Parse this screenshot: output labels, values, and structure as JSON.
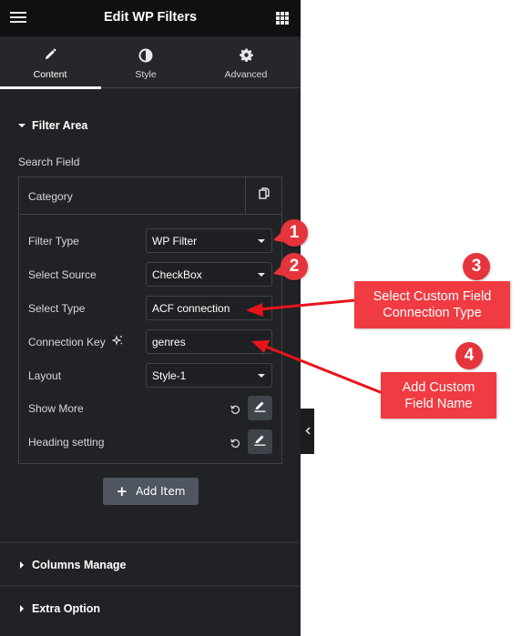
{
  "header": {
    "title": "Edit WP Filters",
    "menu_icon": "hamburger-icon",
    "apps_icon": "grid-icon"
  },
  "tabs": [
    {
      "label": "Content",
      "icon": "pencil-icon",
      "active": true
    },
    {
      "label": "Style",
      "icon": "half-circle-icon",
      "active": false
    },
    {
      "label": "Advanced",
      "icon": "gear-icon",
      "active": false
    }
  ],
  "filter_area": {
    "title": "Filter Area",
    "search_field_label": "Search Field",
    "item": {
      "name": "Category",
      "duplicate_icon": "copy-icon",
      "fields": [
        {
          "label": "Filter Type",
          "type": "select",
          "value": "WP Filter"
        },
        {
          "label": "Select Source",
          "type": "select",
          "value": "CheckBox"
        },
        {
          "label": "Select Type",
          "type": "text",
          "value": "ACF connection"
        },
        {
          "label": "Connection Key",
          "type": "text",
          "value": "genres",
          "label_icon": "ai-sparkle-icon"
        },
        {
          "label": "Layout",
          "type": "select",
          "value": "Style-1"
        },
        {
          "label": "Show More",
          "type": "popover"
        },
        {
          "label": "Heading setting",
          "type": "popover"
        }
      ]
    },
    "add_item_label": "Add Item"
  },
  "sections": [
    {
      "title": "Columns Manage",
      "expanded": false
    },
    {
      "title": "Extra Option",
      "expanded": false
    }
  ],
  "annotations": {
    "pins": [
      "1",
      "2",
      "3",
      "4"
    ],
    "callouts": [
      {
        "text": "Select Custom Field Connection Type"
      },
      {
        "text": "Add Custom Field Name"
      }
    ],
    "colors": {
      "pin": "#e5343c",
      "callout": "#ef3b41",
      "arrow": "#e8141b"
    }
  }
}
